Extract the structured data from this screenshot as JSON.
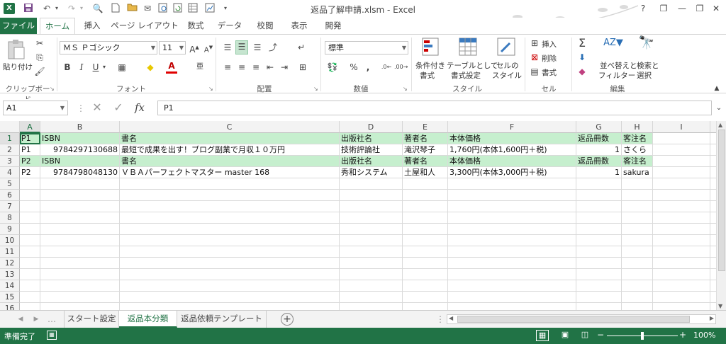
{
  "window": {
    "title": "返品了解申請.xlsm - Excel",
    "help": "?",
    "minimize": "—",
    "maximize": "❐",
    "close": "✕"
  },
  "app_icon": "X",
  "qat": [
    "save-icon",
    "undo-icon",
    "redo-icon",
    "print-preview-icon",
    "new-file-icon",
    "open-folder-icon",
    "email-icon",
    "preview-icon",
    "sheet-icon",
    "chart-icon"
  ],
  "tabs": [
    "ファイル",
    "ホーム",
    "挿入",
    "ページ レイアウト",
    "数式",
    "データ",
    "校閲",
    "表示",
    "開発"
  ],
  "ribbon": {
    "clipboard": {
      "paste": "貼り付け",
      "label": "クリップボード"
    },
    "font": {
      "name": "ＭＳ Ｐゴシック",
      "size": "11",
      "bold": "B",
      "italic": "I",
      "underline": "U",
      "label": "フォント"
    },
    "alignment": {
      "label": "配置"
    },
    "number": {
      "format": "標準",
      "percent": "%",
      "comma": ",",
      "label": "数値"
    },
    "styles": {
      "conditional": [
        "条件付き",
        "書式"
      ],
      "table": [
        "テーブルとして",
        "書式設定"
      ],
      "cell": [
        "セルの",
        "スタイル"
      ],
      "label": "スタイル"
    },
    "cells": {
      "insert": "挿入",
      "delete": "削除",
      "format": "書式",
      "label": "セル"
    },
    "editing": {
      "sort": [
        "並べ替えと",
        "フィルター"
      ],
      "find": [
        "検索と",
        "選択"
      ],
      "label": "編集"
    }
  },
  "formula_bar": {
    "name_box": "A1",
    "fx": "fx",
    "value": "P1"
  },
  "columns": [
    "A",
    "B",
    "C",
    "D",
    "E",
    "F",
    "G",
    "H",
    "I"
  ],
  "rows": [
    "1",
    "2",
    "3",
    "4",
    "5",
    "6",
    "7",
    "8",
    "9",
    "10",
    "11",
    "12",
    "13",
    "14",
    "15",
    "16"
  ],
  "cells": [
    [
      "P1",
      "ISBN",
      "書名",
      "出版社名",
      "著者名",
      "本体価格",
      "返品冊数",
      "客注名"
    ],
    [
      "P1",
      "9784297130688",
      "最短で成果を出す！ブログ副業で月収１０万円",
      "技術評論社",
      "滝沢琴子",
      "1,760円(本体1,600円＋税)",
      "1",
      "さくら"
    ],
    [
      "P2",
      "ISBN",
      "書名",
      "出版社名",
      "著者名",
      "本体価格",
      "返品冊数",
      "客注名"
    ],
    [
      "P2",
      "9784798048130",
      "ＶＢＡパーフェクトマスター master 168",
      "秀和システム",
      "土屋和人",
      "3,300円(本体3,000円＋税)",
      "1",
      "sakura"
    ]
  ],
  "sheets": [
    "スタート設定",
    "返品本分類",
    "返品依頼テンプレート"
  ],
  "active_sheet": 1,
  "status": {
    "ready": "準備完了",
    "zoom": "100%"
  },
  "colors": {
    "excel_green": "#217346",
    "header_fill": "#c6efce"
  }
}
